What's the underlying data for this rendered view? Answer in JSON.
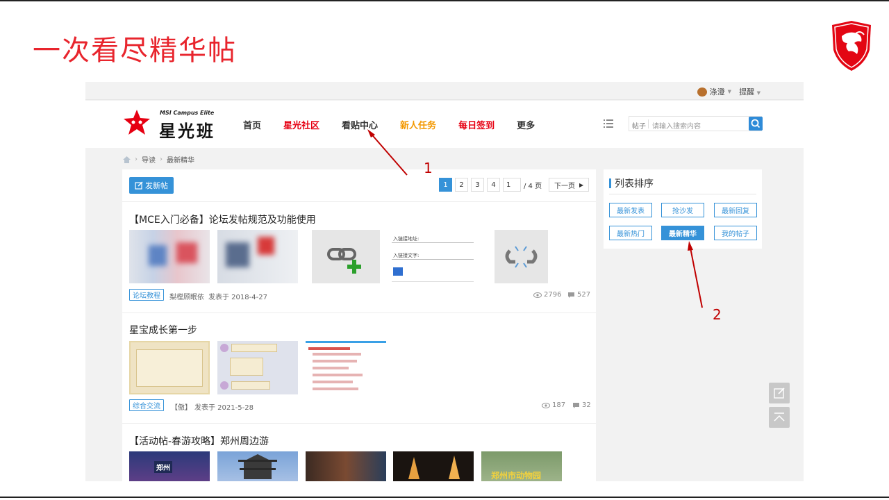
{
  "slide": {
    "title": "一次看尽精华帖",
    "annotation_1": "1",
    "annotation_2": "2",
    "logo_icon": "msi-dragon-shield-icon",
    "brand_color": "#e8252d"
  },
  "topbar": {
    "username": "涤澄",
    "remind": "提醒"
  },
  "header": {
    "logo_sub": "MSI Campus Elite",
    "logo_main": "星光班",
    "nav": [
      "首页",
      "星光社区",
      "看贴中心",
      "新人任务",
      "每日签到",
      "更多"
    ],
    "nav_colors": [
      "#333333",
      "#e60012",
      "#333333",
      "#f39800",
      "#e60012",
      "#333333"
    ]
  },
  "search": {
    "scope": "帖子",
    "placeholder": "请输入搜索内容"
  },
  "breadcrumb": [
    "导读",
    "最新精华"
  ],
  "toolbar": {
    "post_button": "发新帖"
  },
  "pager": {
    "pages": [
      "1",
      "2",
      "3",
      "4"
    ],
    "current": "1",
    "input_value": "1",
    "total": "/ 4 页",
    "next": "下一页"
  },
  "threads": [
    {
      "title": "【MCE入门必备】论坛发帖规范及功能使用",
      "tag": "论坛教程",
      "author": "梨樘顾眠依",
      "posted": "发表于 2018-4-27",
      "views": "2796",
      "replies": "527",
      "link_dialog_line1": "入链接地址:",
      "link_dialog_line2": "入链接文字:"
    },
    {
      "title": "星宝成长第一步",
      "tag": "综合交流",
      "author": "【傲】",
      "posted": "发表于 2021-5-28",
      "views": "187",
      "replies": "32"
    },
    {
      "title": "【活动帖-春游攻略】郑州周边游",
      "image_caption_1": "郑州",
      "image_caption_2": "郑州市动物园"
    }
  ],
  "sidebar": {
    "title": "列表排序",
    "buttons": [
      "最新发表",
      "抢沙发",
      "最新回复",
      "最新热门",
      "最新精华",
      "我的帖子"
    ],
    "active": "最新精华"
  },
  "colors": {
    "accent": "#3592d8",
    "annotation": "#c00000"
  }
}
